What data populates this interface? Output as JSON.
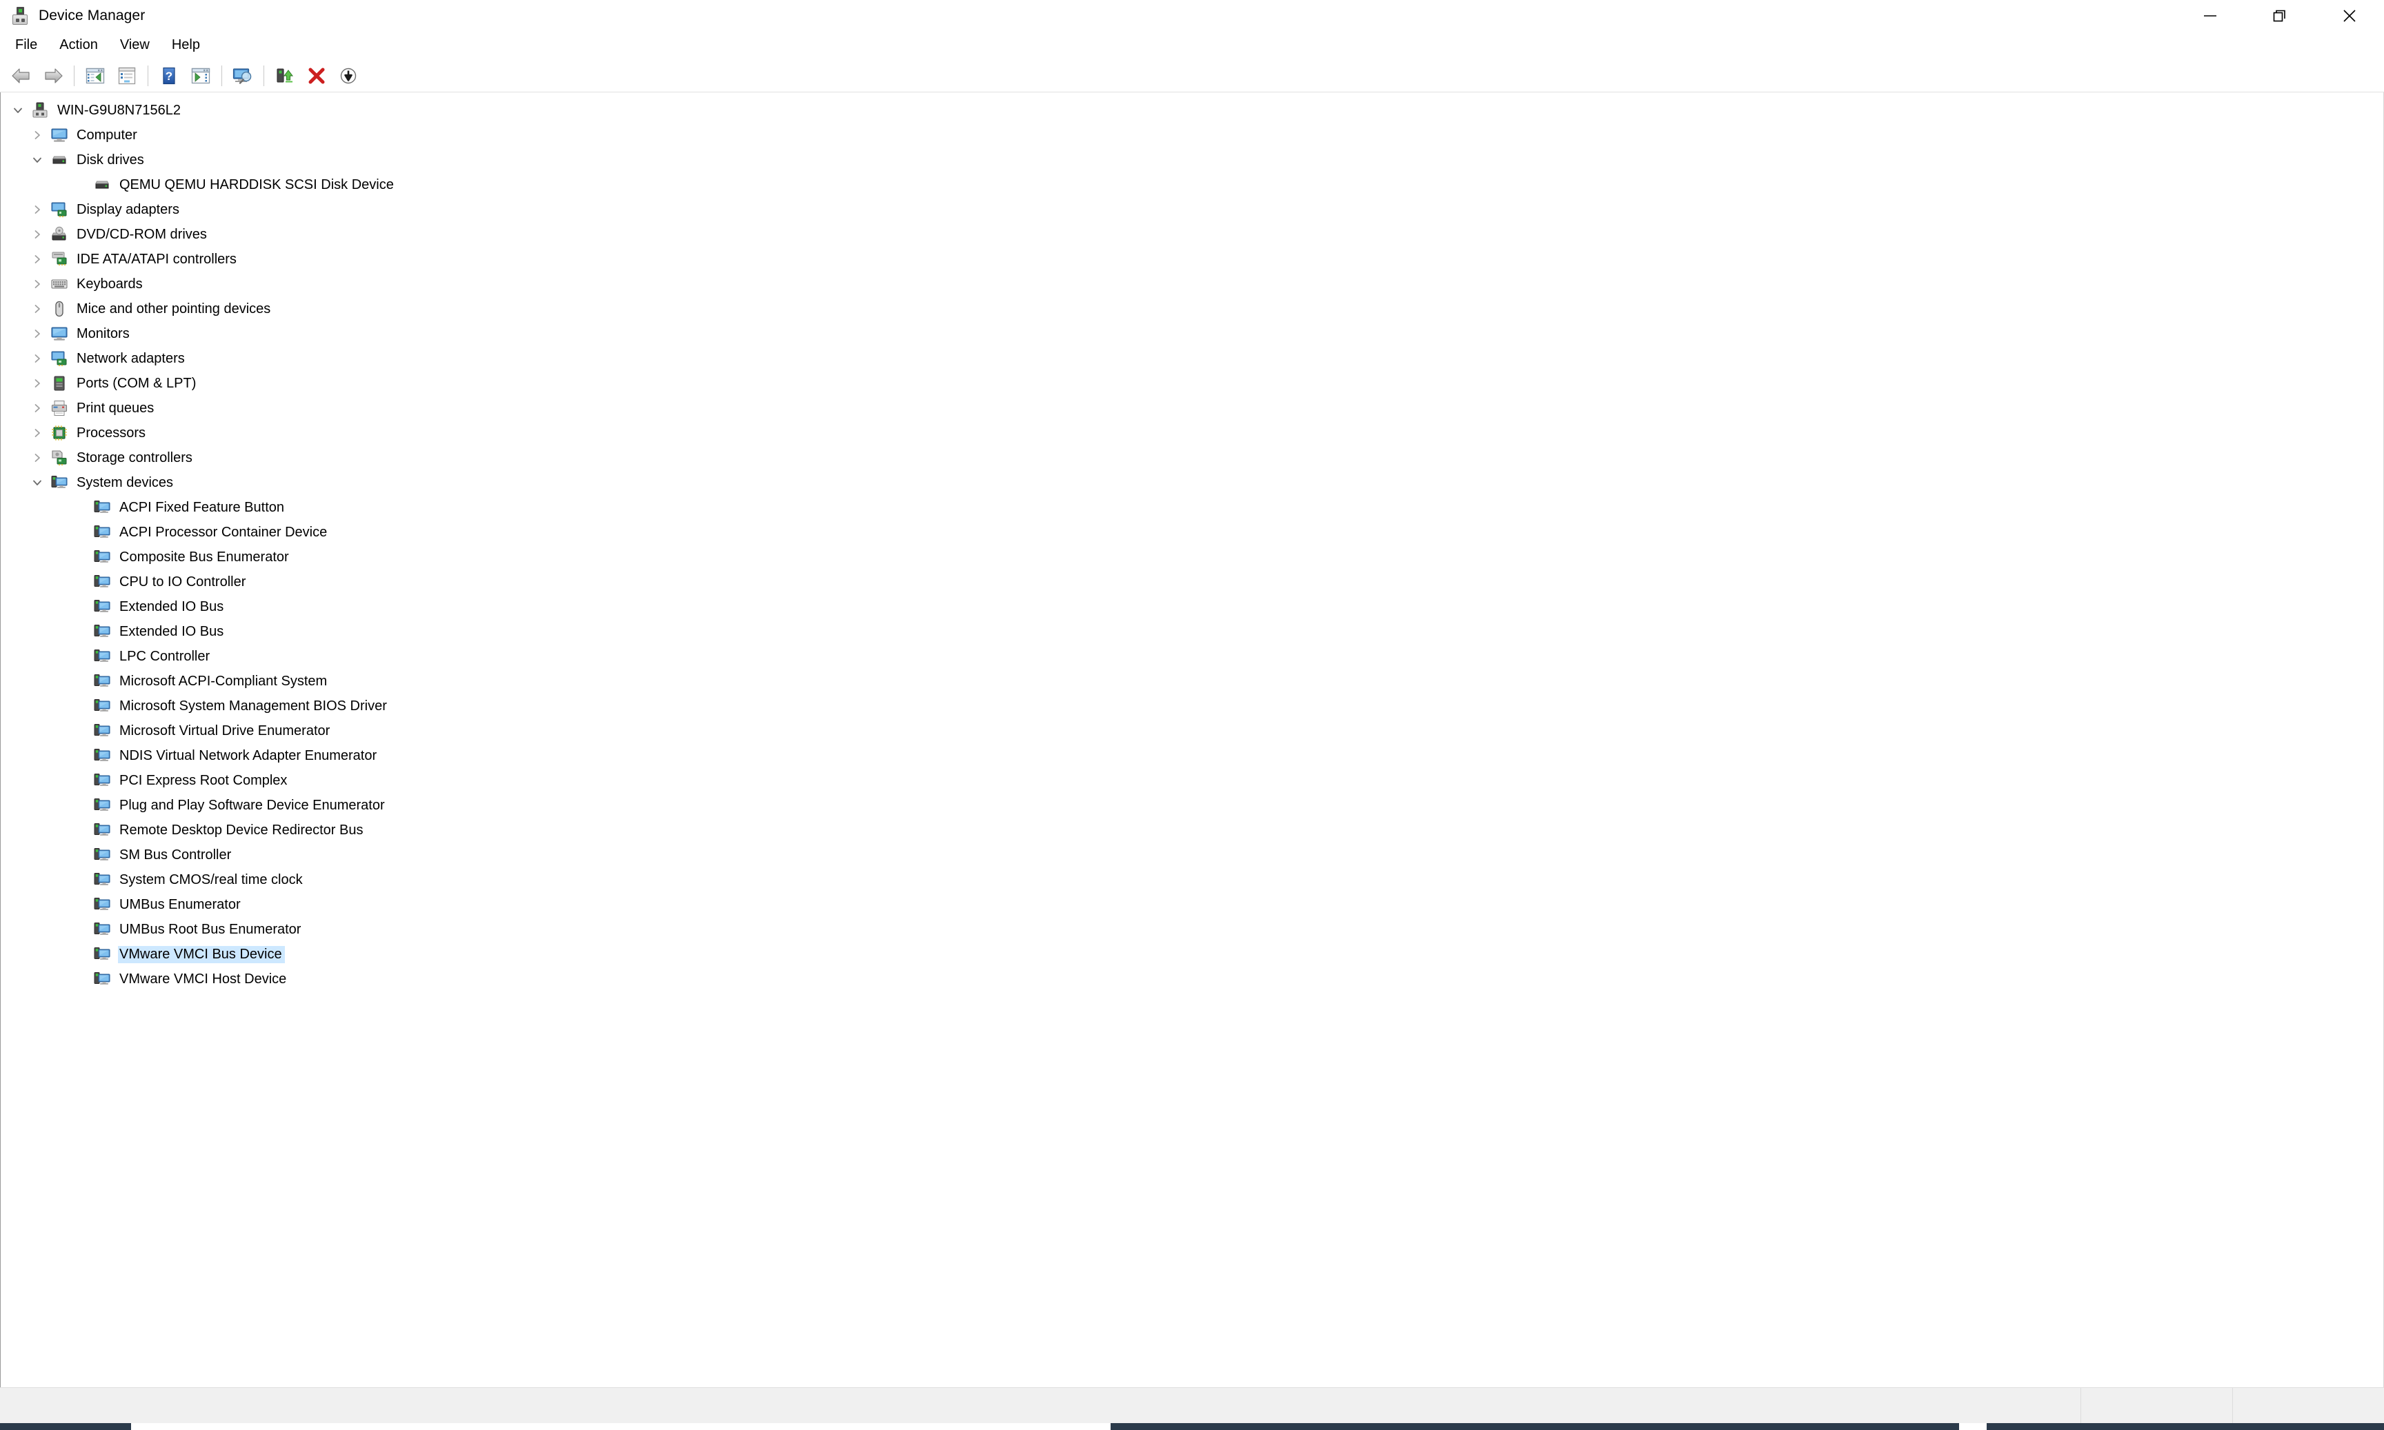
{
  "window": {
    "title": "Device Manager",
    "app_icon": "device-manager-icon",
    "controls": {
      "minimize": "minimize-icon",
      "restore": "restore-icon",
      "close": "close-icon"
    }
  },
  "menubar": {
    "items": [
      {
        "label": "File"
      },
      {
        "label": "Action"
      },
      {
        "label": "View"
      },
      {
        "label": "Help"
      }
    ]
  },
  "toolbar": {
    "buttons": [
      {
        "name": "back-button",
        "icon": "back-arrow-icon"
      },
      {
        "name": "forward-button",
        "icon": "forward-arrow-icon"
      },
      {
        "name": "separator-1",
        "icon": "separator"
      },
      {
        "name": "show-hide-console-tree-button",
        "icon": "console-tree-icon"
      },
      {
        "name": "properties-button",
        "icon": "properties-icon"
      },
      {
        "name": "separator-2",
        "icon": "separator"
      },
      {
        "name": "help-button",
        "icon": "help-question-icon"
      },
      {
        "name": "show-hide-action-pane-button",
        "icon": "action-pane-icon"
      },
      {
        "name": "separator-3",
        "icon": "separator"
      },
      {
        "name": "scan-for-hardware-changes-button",
        "icon": "scan-hardware-icon"
      },
      {
        "name": "separator-4",
        "icon": "separator"
      },
      {
        "name": "update-driver-button",
        "icon": "update-driver-icon"
      },
      {
        "name": "uninstall-device-button",
        "icon": "red-x-icon"
      },
      {
        "name": "disable-device-button",
        "icon": "down-arrow-circle-icon"
      }
    ]
  },
  "tree": {
    "selected": "VMware VMCI Bus Device",
    "selection_color": "#cde8ff",
    "nodes": [
      {
        "label": "WIN-G9U8N7156L2",
        "depth": 0,
        "state": "expanded",
        "icon": "computer-node-icon"
      },
      {
        "label": "Computer",
        "depth": 1,
        "state": "collapsed",
        "icon": "monitor-icon"
      },
      {
        "label": "Disk drives",
        "depth": 1,
        "state": "expanded",
        "icon": "disk-drive-icon"
      },
      {
        "label": "QEMU QEMU HARDDISK SCSI Disk Device",
        "depth": 2,
        "state": "leaf",
        "icon": "disk-drive-icon"
      },
      {
        "label": "Display adapters",
        "depth": 1,
        "state": "collapsed",
        "icon": "display-adapter-icon"
      },
      {
        "label": "DVD/CD-ROM drives",
        "depth": 1,
        "state": "collapsed",
        "icon": "dvd-drive-icon"
      },
      {
        "label": "IDE ATA/ATAPI controllers",
        "depth": 1,
        "state": "collapsed",
        "icon": "ide-controller-icon"
      },
      {
        "label": "Keyboards",
        "depth": 1,
        "state": "collapsed",
        "icon": "keyboard-icon"
      },
      {
        "label": "Mice and other pointing devices",
        "depth": 1,
        "state": "collapsed",
        "icon": "mouse-icon"
      },
      {
        "label": "Monitors",
        "depth": 1,
        "state": "collapsed",
        "icon": "monitor-icon"
      },
      {
        "label": "Network adapters",
        "depth": 1,
        "state": "collapsed",
        "icon": "network-adapter-icon"
      },
      {
        "label": "Ports (COM & LPT)",
        "depth": 1,
        "state": "collapsed",
        "icon": "port-icon"
      },
      {
        "label": "Print queues",
        "depth": 1,
        "state": "collapsed",
        "icon": "printer-icon"
      },
      {
        "label": "Processors",
        "depth": 1,
        "state": "collapsed",
        "icon": "processor-icon"
      },
      {
        "label": "Storage controllers",
        "depth": 1,
        "state": "collapsed",
        "icon": "storage-controller-icon"
      },
      {
        "label": "System devices",
        "depth": 1,
        "state": "expanded",
        "icon": "system-device-icon"
      },
      {
        "label": "ACPI Fixed Feature Button",
        "depth": 2,
        "state": "leaf",
        "icon": "system-device-icon"
      },
      {
        "label": "ACPI Processor Container Device",
        "depth": 2,
        "state": "leaf",
        "icon": "system-device-icon"
      },
      {
        "label": "Composite Bus Enumerator",
        "depth": 2,
        "state": "leaf",
        "icon": "system-device-icon"
      },
      {
        "label": "CPU to IO Controller",
        "depth": 2,
        "state": "leaf",
        "icon": "system-device-icon"
      },
      {
        "label": "Extended IO Bus",
        "depth": 2,
        "state": "leaf",
        "icon": "system-device-icon"
      },
      {
        "label": "Extended IO Bus",
        "depth": 2,
        "state": "leaf",
        "icon": "system-device-icon"
      },
      {
        "label": "LPC Controller",
        "depth": 2,
        "state": "leaf",
        "icon": "system-device-icon"
      },
      {
        "label": "Microsoft ACPI-Compliant System",
        "depth": 2,
        "state": "leaf",
        "icon": "system-device-icon"
      },
      {
        "label": "Microsoft System Management BIOS Driver",
        "depth": 2,
        "state": "leaf",
        "icon": "system-device-icon"
      },
      {
        "label": "Microsoft Virtual Drive Enumerator",
        "depth": 2,
        "state": "leaf",
        "icon": "system-device-icon"
      },
      {
        "label": "NDIS Virtual Network Adapter Enumerator",
        "depth": 2,
        "state": "leaf",
        "icon": "system-device-icon"
      },
      {
        "label": "PCI Express Root Complex",
        "depth": 2,
        "state": "leaf",
        "icon": "system-device-icon"
      },
      {
        "label": "Plug and Play Software Device Enumerator",
        "depth": 2,
        "state": "leaf",
        "icon": "system-device-icon"
      },
      {
        "label": "Remote Desktop Device Redirector Bus",
        "depth": 2,
        "state": "leaf",
        "icon": "system-device-icon"
      },
      {
        "label": "SM Bus Controller",
        "depth": 2,
        "state": "leaf",
        "icon": "system-device-icon"
      },
      {
        "label": "System CMOS/real time clock",
        "depth": 2,
        "state": "leaf",
        "icon": "system-device-icon"
      },
      {
        "label": "UMBus Enumerator",
        "depth": 2,
        "state": "leaf",
        "icon": "system-device-icon"
      },
      {
        "label": "UMBus Root Bus Enumerator",
        "depth": 2,
        "state": "leaf",
        "icon": "system-device-icon"
      },
      {
        "label": "VMware VMCI Bus Device",
        "depth": 2,
        "state": "leaf",
        "icon": "system-device-icon",
        "selected": true
      },
      {
        "label": "VMware VMCI Host Device",
        "depth": 2,
        "state": "leaf",
        "icon": "system-device-icon"
      }
    ]
  },
  "statusbar": {
    "text": ""
  }
}
